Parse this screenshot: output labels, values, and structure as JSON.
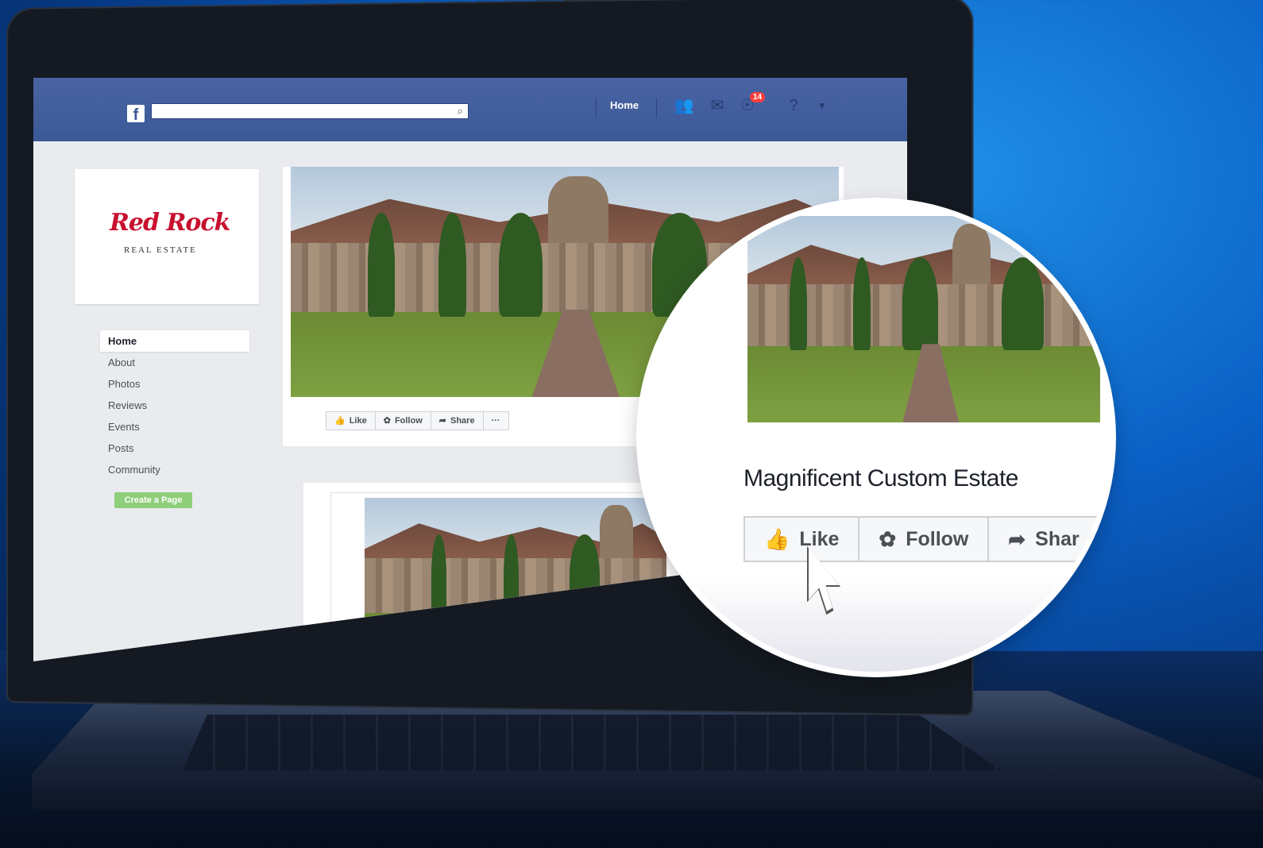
{
  "page": {
    "domain_note": "",
    "background": "#0a5fc4"
  },
  "topbar": {
    "logo": "f",
    "search_icon": "⌕",
    "home_label": "Home",
    "notification_count": "14",
    "icons": [
      "friends-icon",
      "messenger-icon",
      "globe-icon",
      "help-icon",
      "caret-down-icon"
    ]
  },
  "brand": {
    "script": "Red Rock",
    "sub": "REAL ESTATE"
  },
  "sidebar": {
    "items": [
      {
        "label": "Home",
        "active": true
      },
      {
        "label": "About"
      },
      {
        "label": "Photos"
      },
      {
        "label": "Reviews"
      },
      {
        "label": "Events"
      },
      {
        "label": "Posts"
      },
      {
        "label": "Community"
      }
    ],
    "create_page": "Create a Page"
  },
  "cover": {
    "actions": [
      {
        "label": "Like",
        "icon": "thumbs-up-icon"
      },
      {
        "label": "Follow",
        "icon": "rss-icon"
      },
      {
        "label": "Share",
        "icon": "share-arrow-icon"
      },
      {
        "label": "···",
        "icon": "more-icon"
      }
    ]
  },
  "zoom": {
    "title": "Magnificent Custom Estate",
    "actions": [
      {
        "label": "Like",
        "icon": "thumbs-up-icon"
      },
      {
        "label": "Follow",
        "icon": "rss-icon"
      },
      {
        "label": "Shar",
        "icon": "share-arrow-icon"
      }
    ]
  },
  "colors": {
    "fb_blue": "#3b5998",
    "badge_red": "#fa3e3e",
    "create_green": "#8fce7a",
    "brand_red": "#c8102e"
  }
}
